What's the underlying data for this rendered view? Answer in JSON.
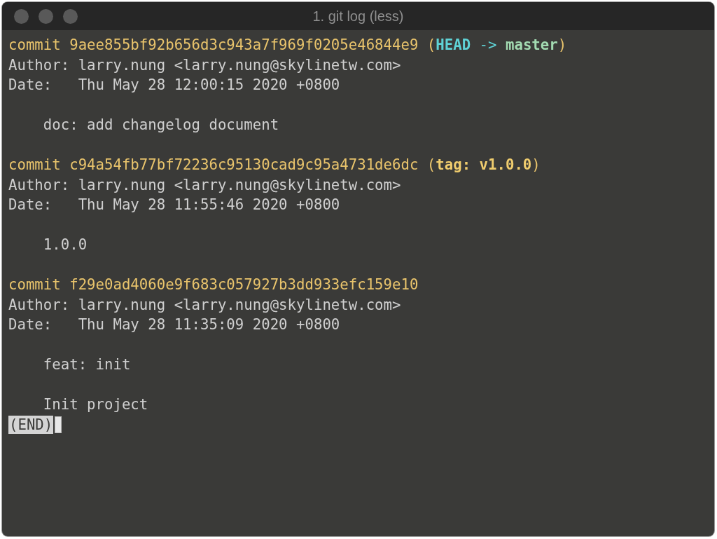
{
  "window": {
    "title": "1. git log (less)"
  },
  "lines": [
    {
      "kind": "text",
      "segments": [
        {
          "kind": "hash",
          "text": "commit 9aee855bf92b656d3c943a7f969f0205e46844e9"
        },
        {
          "kind": "paren",
          "text": "("
        },
        {
          "kind": "head",
          "text": "HEAD"
        },
        {
          "kind": "arrow",
          "text": "->"
        },
        {
          "kind": "branch",
          "text": "master"
        },
        {
          "kind": "paren",
          "text": ")"
        }
      ]
    },
    {
      "kind": "text",
      "segments": [
        {
          "kind": "plain",
          "text": "Author: larry.nung <larry.nung@skylinetw.com>"
        }
      ]
    },
    {
      "kind": "text",
      "segments": [
        {
          "kind": "plain",
          "text": "Date:   Thu May 28 12:00:15 2020 +0800"
        }
      ]
    },
    {
      "kind": "blank"
    },
    {
      "kind": "message",
      "segments": [
        {
          "kind": "plain",
          "text": "doc: add changelog document"
        }
      ]
    },
    {
      "kind": "blank"
    },
    {
      "kind": "text",
      "segments": [
        {
          "kind": "hash",
          "text": "commit c94a54fb77bf72236c95130cad9c95a4731de6dc"
        },
        {
          "kind": "paren",
          "text": "("
        },
        {
          "kind": "tag",
          "text": "tag: v1.0.0"
        },
        {
          "kind": "paren",
          "text": ")"
        }
      ]
    },
    {
      "kind": "text",
      "segments": [
        {
          "kind": "plain",
          "text": "Author: larry.nung <larry.nung@skylinetw.com>"
        }
      ]
    },
    {
      "kind": "text",
      "segments": [
        {
          "kind": "plain",
          "text": "Date:   Thu May 28 11:55:46 2020 +0800"
        }
      ]
    },
    {
      "kind": "blank"
    },
    {
      "kind": "message",
      "segments": [
        {
          "kind": "plain",
          "text": "1.0.0"
        }
      ]
    },
    {
      "kind": "blank"
    },
    {
      "kind": "text",
      "segments": [
        {
          "kind": "hash",
          "text": "commit f29e0ad4060e9f683c057927b3dd933efc159e10"
        }
      ]
    },
    {
      "kind": "text",
      "segments": [
        {
          "kind": "plain",
          "text": "Author: larry.nung <larry.nung@skylinetw.com>"
        }
      ]
    },
    {
      "kind": "text",
      "segments": [
        {
          "kind": "plain",
          "text": "Date:   Thu May 28 11:35:09 2020 +0800"
        }
      ]
    },
    {
      "kind": "blank"
    },
    {
      "kind": "message",
      "segments": [
        {
          "kind": "plain",
          "text": "feat: init"
        }
      ]
    },
    {
      "kind": "blank"
    },
    {
      "kind": "message",
      "segments": [
        {
          "kind": "plain",
          "text": "Init project"
        }
      ]
    },
    {
      "kind": "prompt",
      "segments": [
        {
          "kind": "prompt",
          "text": "(END)"
        }
      ]
    }
  ]
}
